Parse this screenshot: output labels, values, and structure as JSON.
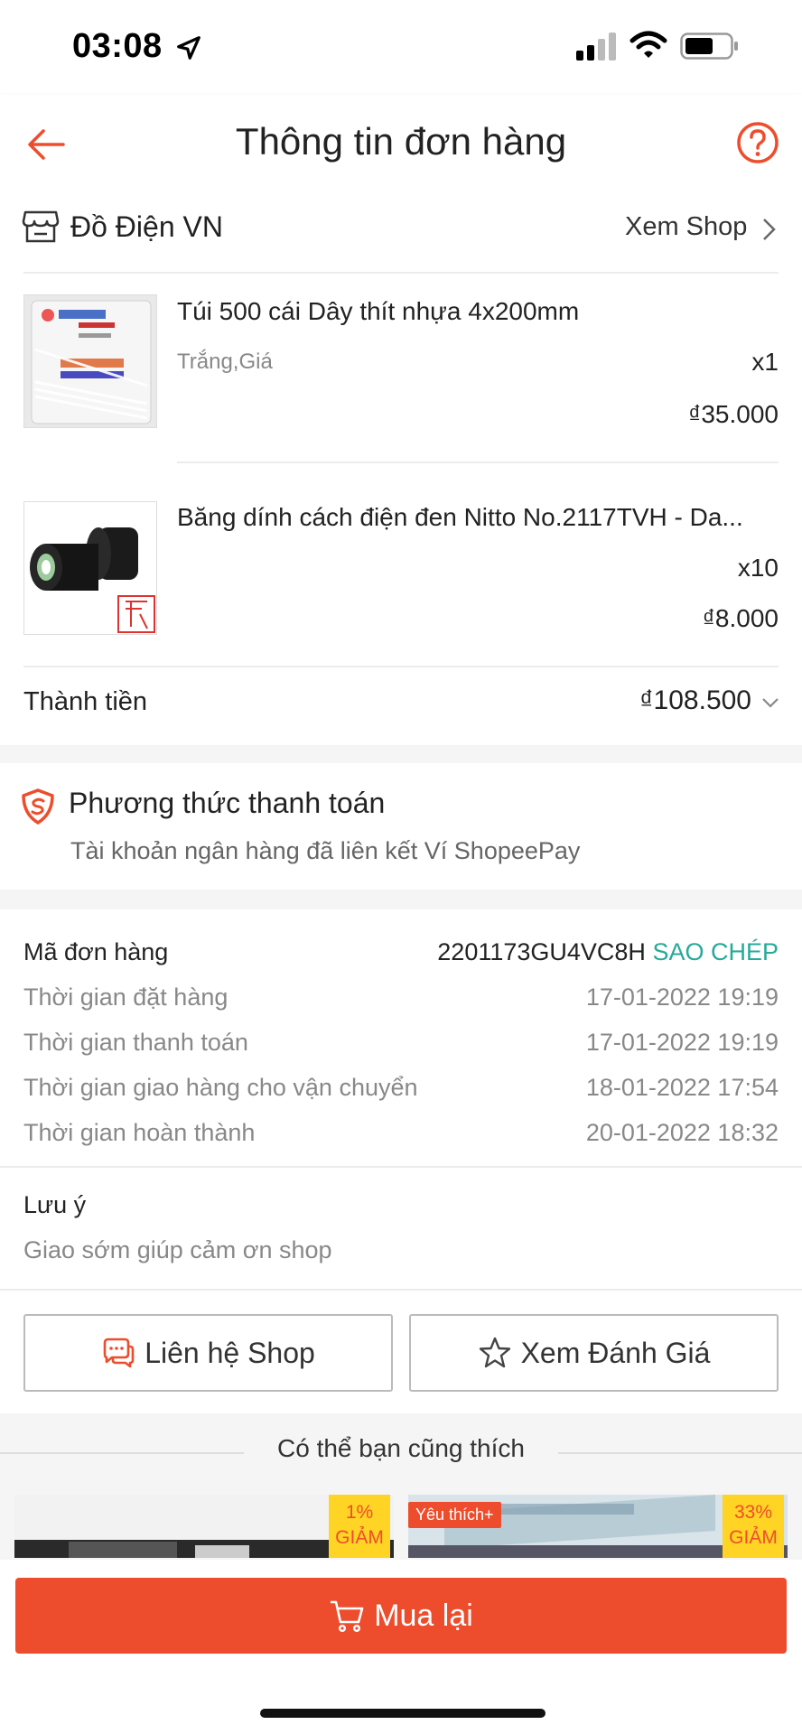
{
  "status_bar": {
    "time": "03:08"
  },
  "header": {
    "title": "Thông tin đơn hàng"
  },
  "shop": {
    "name": "Đồ Điện VN",
    "view_label": "Xem Shop",
    "products": [
      {
        "name": "Túi 500 cái  Dây thít nhựa 4x200mm",
        "variant": "Trắng,Giá",
        "qty": "x1",
        "price": "₫35.000"
      },
      {
        "name": "Băng dính cách điện đen Nitto No.2117TVH - Da...",
        "variant": "",
        "qty": "x10",
        "price": "₫8.000"
      }
    ],
    "total_label": "Thành tiền",
    "total_value": "₫108.500"
  },
  "payment": {
    "title": "Phương thức thanh toán",
    "method": "Tài khoản ngân hàng đã liên kết Ví ShopeePay"
  },
  "order_info": {
    "id_label": "Mã đơn hàng",
    "id_value": "2201173GU4VC8H",
    "copy_label": "SAO CHÉP",
    "rows": [
      {
        "label": "Thời gian đặt hàng",
        "value": "17-01-2022 19:19"
      },
      {
        "label": "Thời gian thanh toán",
        "value": "17-01-2022 19:19"
      },
      {
        "label": "Thời gian giao hàng cho vận chuyển",
        "value": "18-01-2022 17:54"
      },
      {
        "label": "Thời gian hoàn thành",
        "value": "20-01-2022 18:32"
      }
    ],
    "note_label": "Lưu ý",
    "note_value": "Giao sớm giúp cảm ơn shop"
  },
  "actions": {
    "contact_shop": "Liên hệ Shop",
    "view_rating": "Xem Đánh Giá"
  },
  "recommendations": {
    "title": "Có thể bạn cũng thích",
    "items": [
      {
        "discount_pct": "1%",
        "discount_word": "GIẢM",
        "favorite": ""
      },
      {
        "discount_pct": "33%",
        "discount_word": "GIẢM",
        "favorite": "Yêu thích+"
      }
    ]
  },
  "bottom": {
    "buy_again": "Mua lại"
  },
  "colors": {
    "accent": "#ee4d2d",
    "copy": "#26aa99",
    "badge": "#ffd424"
  }
}
